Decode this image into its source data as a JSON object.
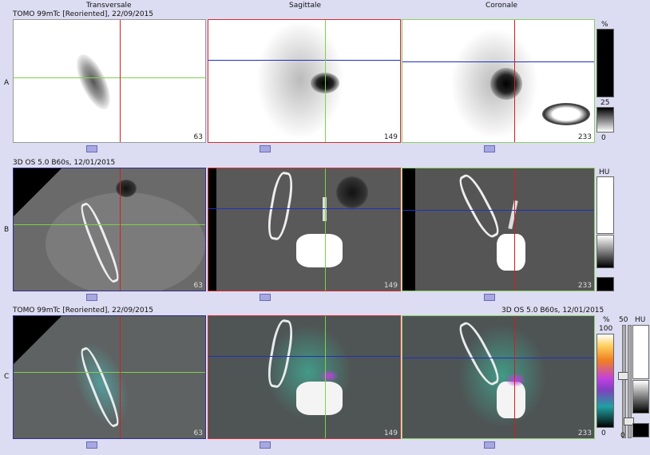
{
  "columns": [
    "Transversale",
    "Sagittale",
    "Coronale"
  ],
  "rows": [
    {
      "label": "A",
      "header_left": "TOMO 99mTc [Reoriented], 22/09/2015",
      "header_right": ""
    },
    {
      "label": "B",
      "header_left": "3D  OS  5.0  B60s, 12/01/2015",
      "header_right": ""
    },
    {
      "label": "C",
      "header_left": "TOMO 99mTc [Reoriented], 22/09/2015",
      "header_right": "3D  OS  5.0  B60s, 12/01/2015"
    }
  ],
  "slices": {
    "A": [
      "63",
      "149",
      "233"
    ],
    "B": [
      "63",
      "149",
      "233"
    ],
    "C": [
      "63",
      "149",
      "233"
    ]
  },
  "scales": {
    "a": {
      "unit": "%",
      "mid": "25",
      "low": "0"
    },
    "b": {
      "unit": "HU"
    },
    "c": {
      "unit": "%",
      "top": "100",
      "low": "0",
      "opacity": "50",
      "opacity_low": "0",
      "hu": "HU"
    }
  },
  "colors": {
    "transversal_cross_h": "#7fd04a",
    "transversal_cross_v": "#d02020",
    "sagittal_border": "#d03030",
    "coronal_border": "#8bd060",
    "transversal_border": "#30308a",
    "cross_blue": "#2030c0"
  }
}
